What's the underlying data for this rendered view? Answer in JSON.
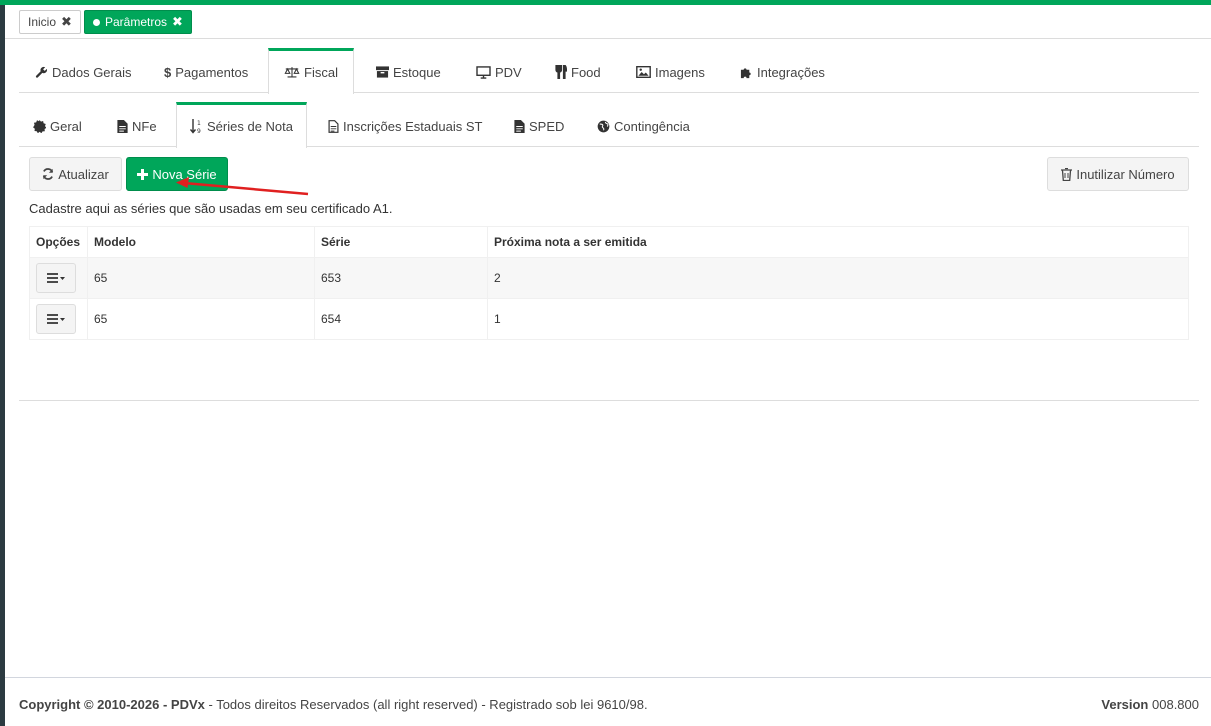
{
  "page_tabs": [
    {
      "label": "Inicio",
      "active": false
    },
    {
      "label": "Parâmetros",
      "active": true
    }
  ],
  "main_tabs": [
    {
      "label": "Dados Gerais",
      "icon": "wrench-icon"
    },
    {
      "label": "Pagamentos",
      "icon": "dollar-icon"
    },
    {
      "label": "Fiscal",
      "icon": "balance-scale-icon",
      "active": true
    },
    {
      "label": "Estoque",
      "icon": "archive-icon"
    },
    {
      "label": "PDV",
      "icon": "monitor-icon"
    },
    {
      "label": "Food",
      "icon": "cutlery-icon"
    },
    {
      "label": "Imagens",
      "icon": "image-icon"
    },
    {
      "label": "Integrações",
      "icon": "puzzle-icon"
    }
  ],
  "sub_tabs": [
    {
      "label": "Geral",
      "icon": "certificate-icon"
    },
    {
      "label": "NFe",
      "icon": "file-icon"
    },
    {
      "label": "Séries de Nota",
      "icon": "sort-numeric-icon",
      "active": true
    },
    {
      "label": "Inscrições Estaduais ST",
      "icon": "file-text-icon"
    },
    {
      "label": "SPED",
      "icon": "file-icon"
    },
    {
      "label": "Contingência",
      "icon": "globe-icon"
    }
  ],
  "toolbar": {
    "refresh_label": "Atualizar",
    "new_series_label": "Nova Série",
    "void_number_label": "Inutilizar Número"
  },
  "description": "Cadastre aqui as séries que são usadas em seu certificado A1.",
  "table": {
    "headers": [
      "Opções",
      "Modelo",
      "Série",
      "Próxima nota a ser emitida"
    ],
    "rows": [
      {
        "modelo": "65",
        "serie": "653",
        "proxima": "2"
      },
      {
        "modelo": "65",
        "serie": "654",
        "proxima": "1"
      }
    ]
  },
  "footer": {
    "copyright_prefix": "Copyright © 2010-2026 - ",
    "brand": "PDVx",
    "copyright_suffix": " - Todos direitos Reservados (all right reserved) - Registrado sob lei 9610/98.",
    "version_label": "Version",
    "version_number": "008.800"
  },
  "colors": {
    "accent": "#00a65a",
    "annotation_arrow": "#e02020"
  }
}
